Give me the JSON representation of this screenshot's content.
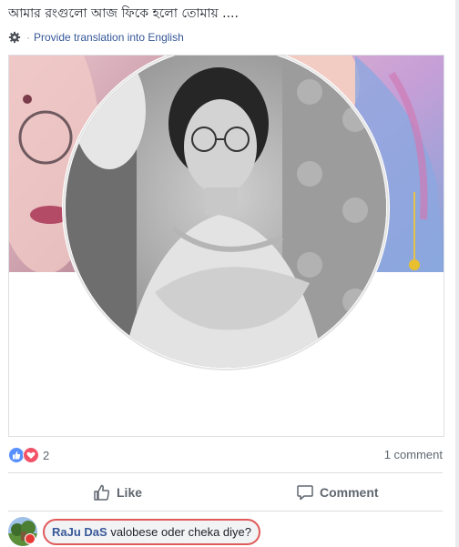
{
  "post": {
    "text": "আমার রংগুলো আজ ফিকে হলো তোমায় ....",
    "translate_link": "Provide translation into English"
  },
  "reactions": {
    "icons": [
      "like-icon",
      "love-icon"
    ],
    "count": "2"
  },
  "comments_summary": "1 comment",
  "actions": {
    "like_label": "Like",
    "comment_label": "Comment"
  },
  "comment": {
    "author": "RaJu DaS",
    "text": "valobese oder cheka diye?"
  },
  "colors": {
    "link": "#365899",
    "like_blue": "#5890ff",
    "love_red": "#f25268",
    "comment_highlight": "#e05a5a"
  }
}
